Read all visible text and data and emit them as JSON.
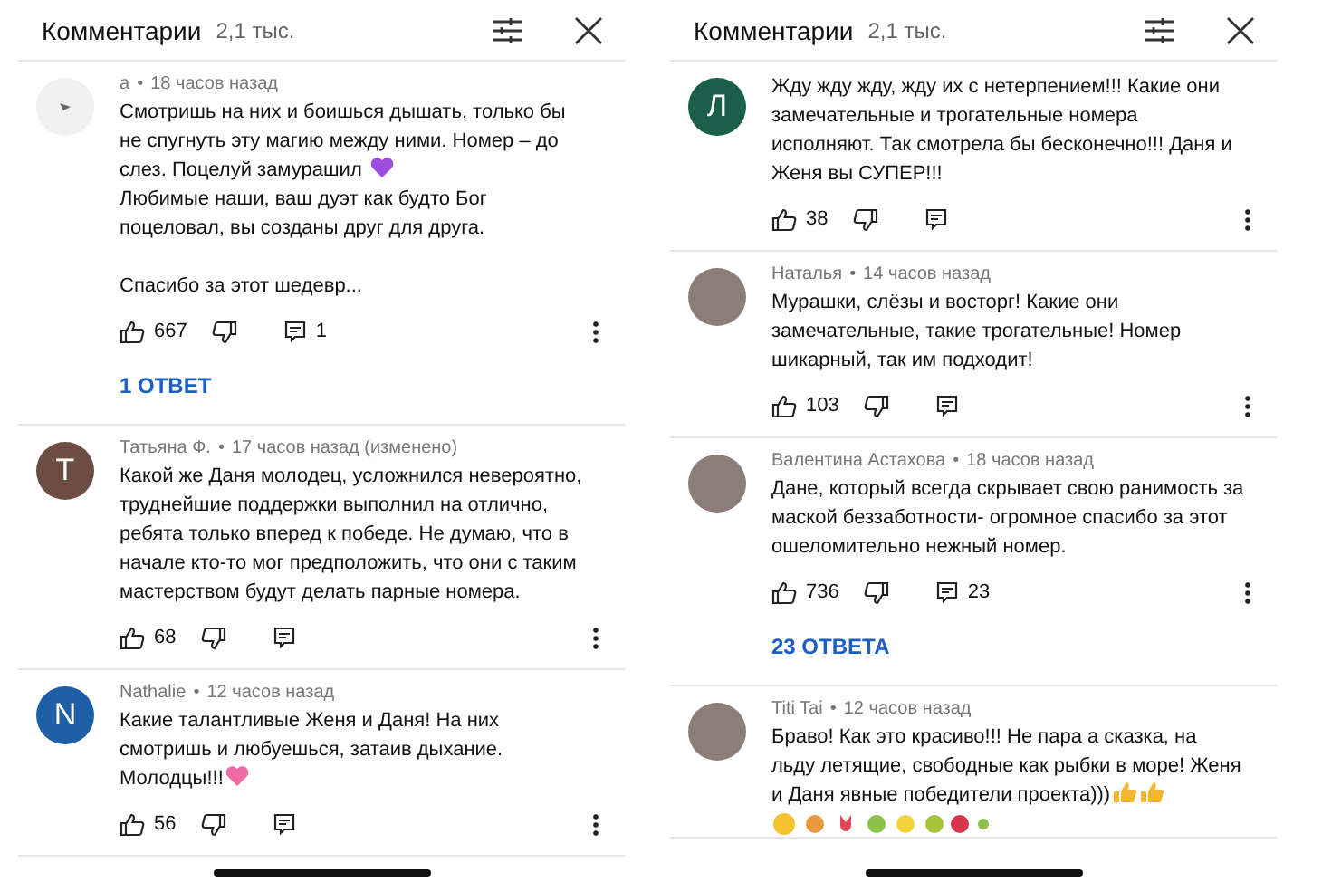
{
  "panels": [
    {
      "header": {
        "title": "Комментарии",
        "count": "2,1 тыс."
      },
      "comments": [
        {
          "avatar": {
            "kind": "default"
          },
          "author": "а",
          "separator": "•",
          "time": "18 часов назад",
          "parts": [
            {
              "kind": "text",
              "text": "Смотришь на них и боишься дышать, только бы не спугнуть эту магию между ними. Номер – до слез. Поцелуй замурашил "
            },
            {
              "kind": "purple-heart"
            },
            {
              "kind": "text",
              "text": "\nЛюбимые наши, ваш дуэт как будто Бог поцеловал, вы созданы друг для друга.\n\nСпасибо за этот шедевр..."
            }
          ],
          "likes": "667",
          "replies_count": "1",
          "replies_link": "1 ОТВЕТ"
        },
        {
          "avatar": {
            "kind": "letter",
            "letter": "Т",
            "color": "#6d4c41"
          },
          "author": "Татьяна Ф.",
          "separator": "•",
          "time": "17 часов назад (изменено)",
          "parts": [
            {
              "kind": "text",
              "text": "Какой же Даня молодец, усложнился невероятно, труднейшие поддержки выполнил на отлично, ребята только вперед к победе. Не думаю, что в начале кто-то мог предположить, что они с таким мастерством будут делать парные номера."
            }
          ],
          "likes": "68"
        },
        {
          "avatar": {
            "kind": "letter",
            "letter": "N",
            "color": "#1e5fa8"
          },
          "author": "Nathalie",
          "separator": "•",
          "time": "12 часов назад",
          "parts": [
            {
              "kind": "text",
              "text": "Какие талантливые Женя и Даня! На них смотришь и любуешься, затаив дыхание. Молодцы!!!"
            },
            {
              "kind": "sparkling-heart"
            }
          ],
          "likes": "56"
        }
      ]
    },
    {
      "header": {
        "title": "Комментарии",
        "count": "2,1 тыс."
      },
      "comments": [
        {
          "avatar": {
            "kind": "letter",
            "letter": "Л",
            "color": "#1b5e4a"
          },
          "parts": [
            {
              "kind": "text",
              "text": "Жду  жду жду, жду их с нетерпением!!! Какие они замечательные и трогательные номера исполняют. Так смотрела бы бесконечно!!! Даня и Женя вы СУПЕР!!!"
            }
          ],
          "likes": "38"
        },
        {
          "avatar": {
            "kind": "photo"
          },
          "author": "Наталья",
          "separator": "•",
          "time": "14 часов назад",
          "parts": [
            {
              "kind": "text",
              "text": "Мурашки, слёзы и восторг! Какие они замечательные, такие трогательные! Номер шикарный, так им подходит!"
            }
          ],
          "likes": "103"
        },
        {
          "avatar": {
            "kind": "photo"
          },
          "author": "Валентина Астахова",
          "separator": "•",
          "time": "18 часов назад",
          "parts": [
            {
              "kind": "text",
              "text": "Дане, который всегда скрывает свою ранимость за маской беззаботности- огромное спасибо за этот ошеломительно нежный  номер."
            }
          ],
          "likes": "736",
          "replies_count": "23",
          "replies_link": "23 ОТВЕТА"
        },
        {
          "avatar": {
            "kind": "photo"
          },
          "author": "Titi Tai",
          "separator": "•",
          "time": "12 часов назад",
          "parts": [
            {
              "kind": "text",
              "text": "Браво! Как это красиво!!! Не пара а сказка, на льду летящие, свободные как рыбки в море! Женя и Даня явные победители проекта)))"
            },
            {
              "kind": "thumbs-up"
            },
            {
              "kind": "thumbs-up"
            },
            {
              "kind": "emoji-row"
            }
          ]
        }
      ]
    }
  ]
}
